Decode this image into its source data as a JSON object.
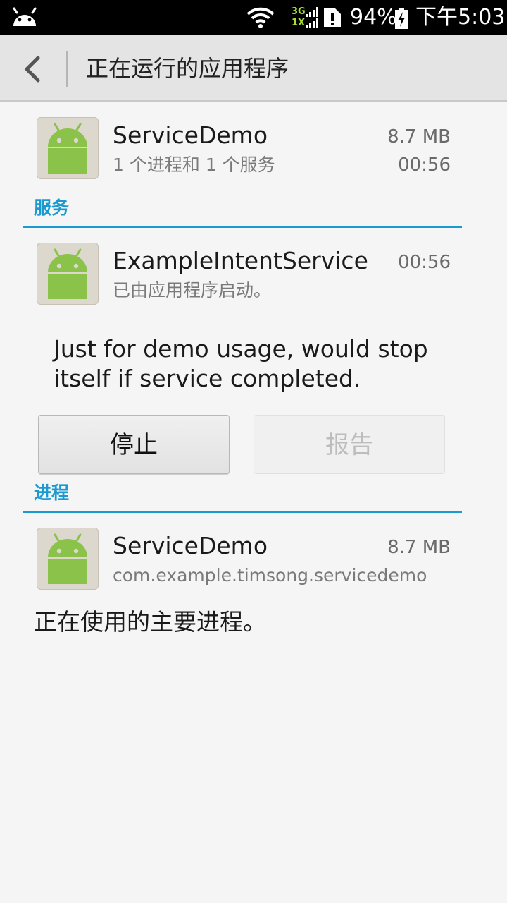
{
  "status_bar": {
    "network_top": "3G",
    "network_bottom": "1X",
    "battery_text": "94%",
    "time": "下午5:03",
    "icons": [
      "android-notification-icon",
      "wifi-icon",
      "signal-icon",
      "sim-icon",
      "battery-charging-icon"
    ]
  },
  "action_bar": {
    "title": "正在运行的应用程序"
  },
  "app_entry": {
    "name": "ServiceDemo",
    "summary": "1 个进程和 1 个服务",
    "size": "8.7 MB",
    "time": "00:56"
  },
  "services_section": {
    "label": "服务",
    "item": {
      "name": "ExampleIntentService",
      "status": "已由应用程序启动。",
      "time": "00:56",
      "description": "Just for demo usage, would stop itself if service completed."
    },
    "buttons": {
      "stop_label": "停止",
      "report_label": "报告"
    }
  },
  "processes_section": {
    "label": "进程",
    "item": {
      "name": "ServiceDemo",
      "package": "com.example.timsong.servicedemo",
      "size": "8.7 MB"
    },
    "note": "正在使用的主要进程。"
  },
  "colors": {
    "accent": "#1a9ad0",
    "android_green": "#8bc34a",
    "action_bar_bg": "#e4e4e4",
    "background": "#f5f5f5"
  }
}
